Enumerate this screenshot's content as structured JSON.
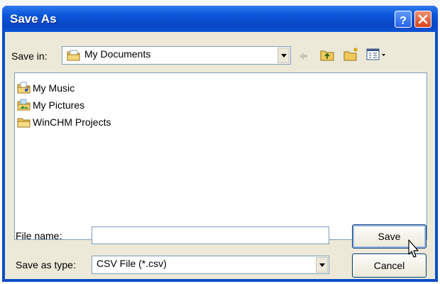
{
  "window": {
    "title": "Save As",
    "help_icon": "question-mark-icon",
    "close_icon": "close-x-icon"
  },
  "save_in": {
    "label": "Save in:",
    "value": "My Documents",
    "icon": "my-documents-folder-icon"
  },
  "toolbar": {
    "back_icon": "back-arrow-icon",
    "up_icon": "up-one-level-folder-icon",
    "new_folder_icon": "new-folder-icon",
    "views_icon": "views-menu-icon"
  },
  "files": [
    {
      "name": "My Music",
      "icon": "music-folder-icon"
    },
    {
      "name": "My Pictures",
      "icon": "pictures-folder-icon"
    },
    {
      "name": "WinCHM Projects",
      "icon": "folder-icon"
    }
  ],
  "filename": {
    "label": "File name:",
    "value": ""
  },
  "filetype": {
    "label": "Save as type:",
    "value": "CSV File (*.csv)"
  },
  "buttons": {
    "save": "Save",
    "cancel": "Cancel"
  },
  "colors": {
    "titlebar": "#0a4ec9",
    "dialog_face": "#ece9d8",
    "field_border": "#7f9db9",
    "close_button": "#d7421a"
  }
}
